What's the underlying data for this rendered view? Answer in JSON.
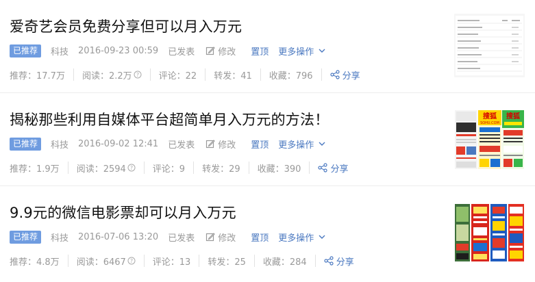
{
  "articles": [
    {
      "title": "爱奇艺会员免费分享但可以月入万元",
      "badge": "已推荐",
      "category": "科技",
      "date": "2016-09-23 00:59",
      "status": "已发表",
      "edit_label": "修改",
      "pin_label": "置顶",
      "more_label": "更多操作",
      "stats": {
        "recommend": "推荐：17.7万",
        "read": "阅读：2.2万",
        "comment": "评论：22",
        "forward": "转发：41",
        "collect": "收藏：796"
      },
      "share_label": "分享"
    },
    {
      "title": "揭秘那些利用自媒体平台超简单月入万元的方法！",
      "badge": "已推荐",
      "category": "科技",
      "date": "2016-09-02 12:41",
      "status": "已发表",
      "edit_label": "修改",
      "pin_label": "置顶",
      "more_label": "更多操作",
      "stats": {
        "recommend": "推荐：1.9万",
        "read": "阅读：2594",
        "comment": "评论：9",
        "forward": "转发：29",
        "collect": "收藏：390"
      },
      "share_label": "分享"
    },
    {
      "title": "9.9元的微信电影票却可以月入万元",
      "badge": "已推荐",
      "category": "科技",
      "date": "2016-07-06 13:20",
      "status": "已发表",
      "edit_label": "修改",
      "pin_label": "置顶",
      "more_label": "更多操作",
      "stats": {
        "recommend": "推荐：4.8万",
        "read": "阅读：6467",
        "comment": "评论：13",
        "forward": "转发：25",
        "collect": "收藏：284"
      },
      "share_label": "分享"
    }
  ],
  "thumbnail_text": {
    "sohu_logo": "搜狐",
    "sohu_domain": "SOHU.COM"
  },
  "colors": {
    "badge": "#6f9ce0",
    "link": "#4a78c0",
    "muted": "#999999",
    "title": "#111111"
  }
}
